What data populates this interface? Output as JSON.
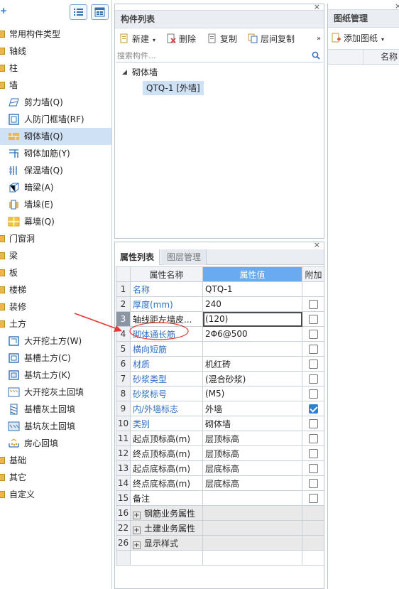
{
  "left": {
    "toolbar": {
      "plus": "+"
    },
    "tree": [
      {
        "label": "常用构件类型",
        "level": 0,
        "icon": "folder-icon"
      },
      {
        "label": "轴线",
        "level": 0,
        "icon": "folder-icon"
      },
      {
        "label": "柱",
        "level": 0,
        "icon": "folder-icon"
      },
      {
        "label": "墙",
        "level": 0,
        "icon": "folder-icon"
      },
      {
        "label": "剪力墙(Q)",
        "level": 1,
        "icon": "shear-wall-icon"
      },
      {
        "label": "人防门框墙(RF)",
        "level": 1,
        "icon": "frame-wall-icon"
      },
      {
        "label": "砌体墙(Q)",
        "level": 1,
        "icon": "masonry-wall-icon",
        "selected": true
      },
      {
        "label": "砌体加筋(Y)",
        "level": 1,
        "icon": "masonry-rebar-icon"
      },
      {
        "label": "保温墙(Q)",
        "level": 1,
        "icon": "insulation-wall-icon"
      },
      {
        "label": "暗梁(A)",
        "level": 1,
        "icon": "hidden-beam-icon"
      },
      {
        "label": "墙垛(E)",
        "level": 1,
        "icon": "wall-pier-icon"
      },
      {
        "label": "幕墙(Q)",
        "level": 1,
        "icon": "curtain-wall-icon"
      },
      {
        "label": "门窗洞",
        "level": 0,
        "icon": "folder-icon"
      },
      {
        "label": "梁",
        "level": 0,
        "icon": "folder-icon"
      },
      {
        "label": "板",
        "level": 0,
        "icon": "folder-icon"
      },
      {
        "label": "楼梯",
        "level": 0,
        "icon": "folder-icon"
      },
      {
        "label": "装修",
        "level": 0,
        "icon": "folder-icon"
      },
      {
        "label": "土方",
        "level": 0,
        "icon": "folder-icon"
      },
      {
        "label": "大开挖土方(W)",
        "level": 1,
        "icon": "excavation-icon"
      },
      {
        "label": "基槽土方(C)",
        "level": 1,
        "icon": "trench-icon"
      },
      {
        "label": "基坑土方(K)",
        "level": 1,
        "icon": "pit-icon"
      },
      {
        "label": "大开挖灰土回填",
        "level": 1,
        "icon": "excavation-backfill-icon"
      },
      {
        "label": "基槽灰土回填",
        "level": 1,
        "icon": "trench-backfill-icon"
      },
      {
        "label": "基坑灰土回填",
        "level": 1,
        "icon": "pit-backfill-icon"
      },
      {
        "label": "房心回填",
        "level": 1,
        "icon": "room-backfill-icon"
      },
      {
        "label": "基础",
        "level": 0,
        "icon": "folder-icon"
      },
      {
        "label": "其它",
        "level": 0,
        "icon": "folder-icon"
      },
      {
        "label": "自定义",
        "level": 0,
        "icon": "folder-icon"
      }
    ]
  },
  "component_panel": {
    "title": "构件列表",
    "close": "×",
    "toolbar": {
      "new": "新建",
      "delete": "删除",
      "copy": "复制",
      "floor_copy": "层间复制",
      "more": "»"
    },
    "search": {
      "placeholder": "搜索构件..."
    },
    "tree": {
      "root": "砌体墙",
      "child": "QTQ-1 [外墙]"
    }
  },
  "property_panel": {
    "close": "×",
    "tabs": {
      "active": "属性列表",
      "inactive": "图层管理"
    },
    "headers": {
      "name": "属性名称",
      "value": "属性值",
      "extra": "附加"
    },
    "rows": [
      {
        "num": "1",
        "name": "名称",
        "value": "QTQ-1",
        "blue": true,
        "check": null
      },
      {
        "num": "2",
        "name": "厚度(mm)",
        "value": "240",
        "blue": true,
        "check": false
      },
      {
        "num": "3",
        "name": "轴线距左墙皮...",
        "value": "(120)",
        "blue": false,
        "check": false,
        "active": true
      },
      {
        "num": "4",
        "name": "砌体通长筋",
        "value": "2Φ6@500",
        "blue": true,
        "check": false
      },
      {
        "num": "5",
        "name": "横向短筋",
        "value": "",
        "blue": true,
        "check": false
      },
      {
        "num": "6",
        "name": "材质",
        "value": "机红砖",
        "blue": true,
        "check": false
      },
      {
        "num": "7",
        "name": "砂浆类型",
        "value": "(混合砂浆)",
        "blue": true,
        "check": false
      },
      {
        "num": "8",
        "name": "砂浆标号",
        "value": "(M5)",
        "blue": true,
        "check": false
      },
      {
        "num": "9",
        "name": "内/外墙标志",
        "value": "外墙",
        "blue": true,
        "check": true
      },
      {
        "num": "10",
        "name": "类别",
        "value": "砌体墙",
        "blue": true,
        "check": false
      },
      {
        "num": "11",
        "name": "起点顶标高(m)",
        "value": "层顶标高",
        "blue": false,
        "check": false
      },
      {
        "num": "12",
        "name": "终点顶标高(m)",
        "value": "层顶标高",
        "blue": false,
        "check": false
      },
      {
        "num": "13",
        "name": "起点底标高(m)",
        "value": "层底标高",
        "blue": false,
        "check": false
      },
      {
        "num": "14",
        "name": "终点底标高(m)",
        "value": "层底标高",
        "blue": false,
        "check": false
      },
      {
        "num": "15",
        "name": "备注",
        "value": "",
        "blue": false,
        "check": false
      }
    ],
    "groups": [
      {
        "num": "16",
        "label": "钢筋业务属性"
      },
      {
        "num": "22",
        "label": "土建业务属性"
      },
      {
        "num": "26",
        "label": "显示样式"
      }
    ]
  },
  "drawing_panel": {
    "title": "图纸管理",
    "close": "×",
    "add_label": "添加图纸",
    "column_name": "名称"
  },
  "colors": {
    "accent": "#69aaf0",
    "selection": "#cfe1f5",
    "blue_text": "#2f6fc5",
    "annotation": "#e53935"
  }
}
